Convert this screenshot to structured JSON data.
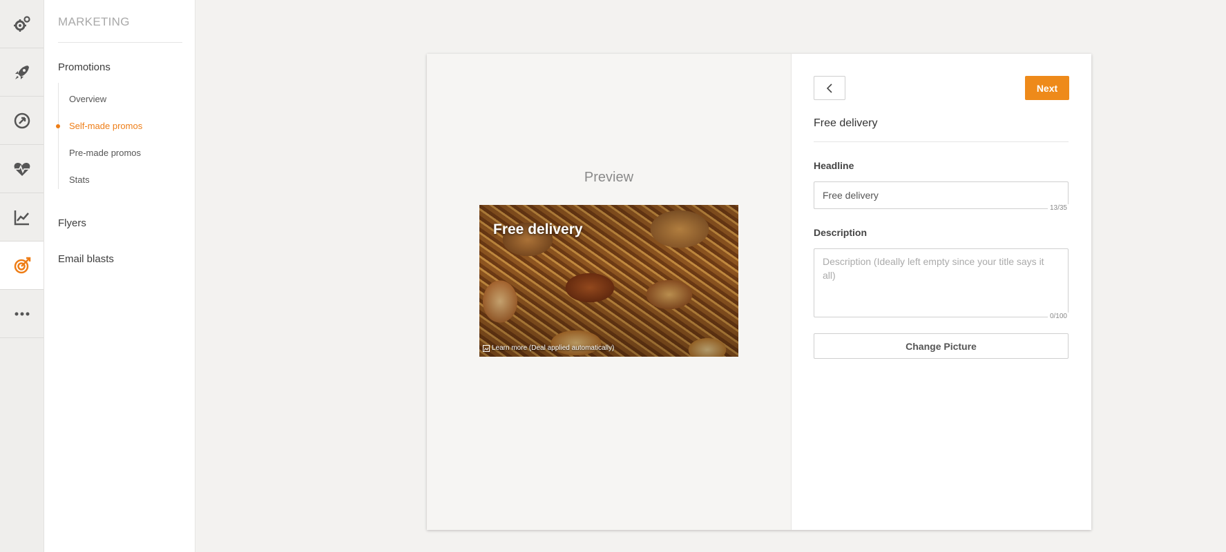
{
  "sidebar": {
    "icons": [
      {
        "name": "settings-gears-icon",
        "active": false
      },
      {
        "name": "rocket-icon",
        "active": false
      },
      {
        "name": "speedometer-icon",
        "active": false
      },
      {
        "name": "heart-pulse-icon",
        "active": false
      },
      {
        "name": "line-chart-icon",
        "active": false
      },
      {
        "name": "target-icon",
        "active": true
      },
      {
        "name": "more-dots-icon",
        "active": false
      }
    ],
    "accent_color": "#ee7d16"
  },
  "subnav": {
    "title": "MARKETING",
    "section_promotions": "Promotions",
    "children": {
      "overview": "Overview",
      "self_made": "Self-made promos",
      "pre_made": "Pre-made promos",
      "stats": "Stats"
    },
    "section_flyers": "Flyers",
    "section_email": "Email blasts"
  },
  "preview": {
    "label": "Preview",
    "headline": "Free delivery",
    "footer": "Learn more (Deal applied automatically)"
  },
  "form": {
    "next_label": "Next",
    "title": "Free delivery",
    "headline_label": "Headline",
    "headline_value": "Free delivery",
    "headline_counter": "13/35",
    "description_label": "Description",
    "description_placeholder": "Description (Ideally left empty since your title says it all)",
    "description_counter": "0/100",
    "change_picture_label": "Change Picture"
  }
}
